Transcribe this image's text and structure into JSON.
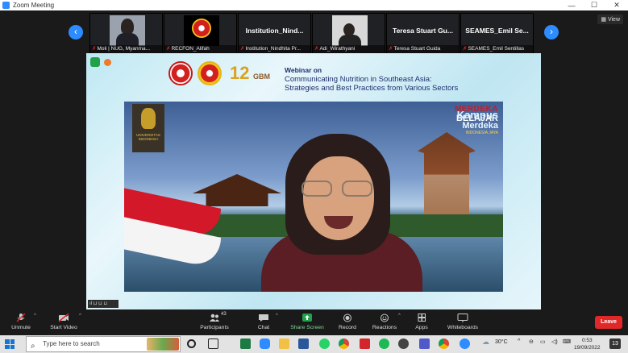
{
  "window": {
    "title": "Zoom Meeting",
    "minimize": "—",
    "maximize": "☐",
    "close": "✕"
  },
  "strip": {
    "prev": "‹",
    "next": "›",
    "view_label": "View",
    "thumbnails": [
      {
        "name": "Moli | NUG, Myanma...",
        "big": ""
      },
      {
        "name": "RECFON_Alifah",
        "big": ""
      },
      {
        "name": "Institution_Nindhita Pr...",
        "big": "Institution_Nind..."
      },
      {
        "name": "Adi_Wirathyani",
        "big": ""
      },
      {
        "name": "Teresa Stuart Guida",
        "big": "Teresa Stuart Gu..."
      },
      {
        "name": "SEAMES_Emil Sentillas",
        "big": "SEAMES_Emil Se..."
      }
    ]
  },
  "share": {
    "webinar_head": "Webinar on",
    "webinar_line1": "Communicating Nutrition in Southeast Asia:",
    "webinar_line2": "Strategies and Best Practices from Various Sectors",
    "logo_12": "12",
    "logo_gbm": "GBM",
    "ui_badge": "UNIVERSITAS INDONESIA",
    "merdeka": "MERDEKA",
    "belajar": "BELAJAR",
    "kampus": "Kampus",
    "merdeka2": "Merdeka",
    "indonesia": "INDONESIA JAYA",
    "bottom_badge": "ıl ⊔ ⊔ ⊔"
  },
  "toolbar": {
    "unmute": "Unmute",
    "start_video": "Start Video",
    "participants": "Participants",
    "participants_count": "43",
    "chat": "Chat",
    "share_screen": "Share Screen",
    "record": "Record",
    "reactions": "Reactions",
    "apps": "Apps",
    "whiteboards": "Whiteboards",
    "leave": "Leave"
  },
  "taskbar": {
    "search_placeholder": "Type here to search",
    "weather": "30°C",
    "time": "0:53",
    "date": "19/09/2022",
    "notif_count": "13"
  },
  "colors": {
    "accent": "#2d8cff",
    "leave": "#e02828",
    "share_green": "#23a04a"
  }
}
